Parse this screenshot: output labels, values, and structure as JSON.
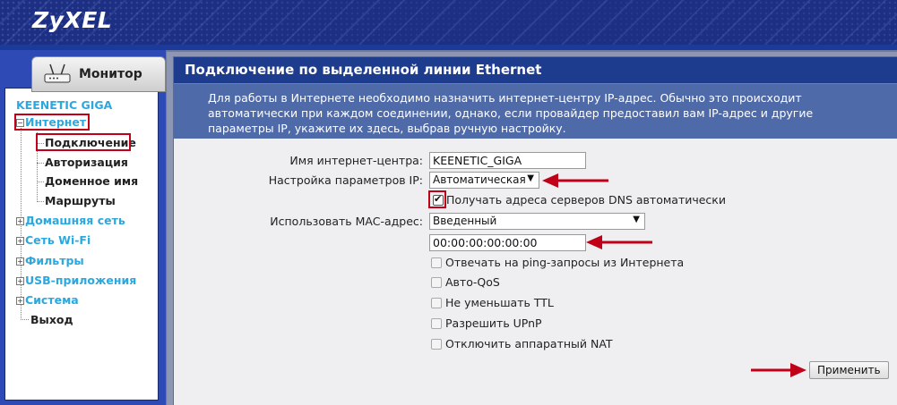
{
  "brand": {
    "logo": "ZyXEL"
  },
  "sidebar": {
    "monitor_tab": "Монитор",
    "model": "KEENETIC GIGA",
    "items": [
      {
        "label": "Интернет",
        "expander": "−"
      },
      {
        "label": "Подключение"
      },
      {
        "label": "Авторизация"
      },
      {
        "label": "Доменное имя"
      },
      {
        "label": "Маршруты"
      },
      {
        "label": "Домашняя сеть",
        "expander": "+"
      },
      {
        "label": "Сеть Wi-Fi",
        "expander": "+"
      },
      {
        "label": "Фильтры",
        "expander": "+"
      },
      {
        "label": "USB-приложения",
        "expander": "+"
      },
      {
        "label": "Система",
        "expander": "+"
      },
      {
        "label": "Выход"
      }
    ]
  },
  "main": {
    "title": "Подключение по выделенной линии Ethernet",
    "description": "Для работы в Интернете необходимо назначить интернет-центру IP-адрес. Обычно это происходит автоматически при каждом соединении, однако, если провайдер предоставил вам IP-адрес и другие параметры IP, укажите их здесь, выбрав ручную настройку."
  },
  "form": {
    "hostname_label": "Имя интернет-центра:",
    "hostname_value": "KEENETIC_GIGA",
    "ip_mode_label": "Настройка параметров IP:",
    "ip_mode_value": "Автоматическая",
    "dns_auto_label": "Получать адреса серверов DNS автоматически",
    "dns_auto_checked": true,
    "mac_label": "Использовать MAC-адрес:",
    "mac_mode_value": "Введенный",
    "mac_value": "00:00:00:00:00:00",
    "checkboxes": [
      {
        "label": "Отвечать на ping-запросы из Интернета",
        "checked": false
      },
      {
        "label": "Авто-QoS",
        "checked": false
      },
      {
        "label": "Не уменьшать TTL",
        "checked": false
      },
      {
        "label": "Разрешить UPnP",
        "checked": false
      },
      {
        "label": "Отключить аппаратный NAT",
        "checked": false
      }
    ],
    "apply_button": "Применить"
  },
  "colors": {
    "banner": "#1d2f82",
    "sidebar": "#2e4bb5",
    "title_bar": "#1e3c8d",
    "desc_bg": "#4f6aa8",
    "link_cyan": "#2aa8e0",
    "highlight_red": "#c00018"
  }
}
